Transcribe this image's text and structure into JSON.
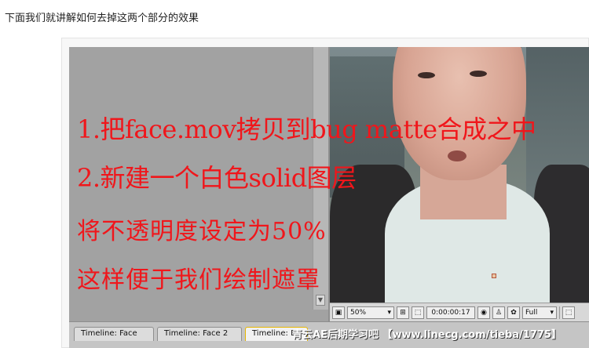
{
  "caption": "下面我们就讲解如何去掉这两个部分的效果",
  "overlay_lines": [
    "1.把face.mov拷贝到bug matte合成之中",
    "2.新建一个白色solid图层",
    "将不透明度设定为50%",
    "这样便于我们绘制遮罩"
  ],
  "viewer_bar": {
    "zoom_value": "50%",
    "timecode": "0:00:00:17",
    "resolution_value": "Full"
  },
  "tabs": [
    {
      "label": "Timeline: Face"
    },
    {
      "label": "Timeline: Face 2"
    },
    {
      "label": "Timeline: B"
    }
  ],
  "watermark": "青云AE后期学习吧 【www.linecg.com/tieba/1775】",
  "colors": {
    "overlay_text": "#f0161b",
    "panel_gray": "#8f8f8f"
  }
}
